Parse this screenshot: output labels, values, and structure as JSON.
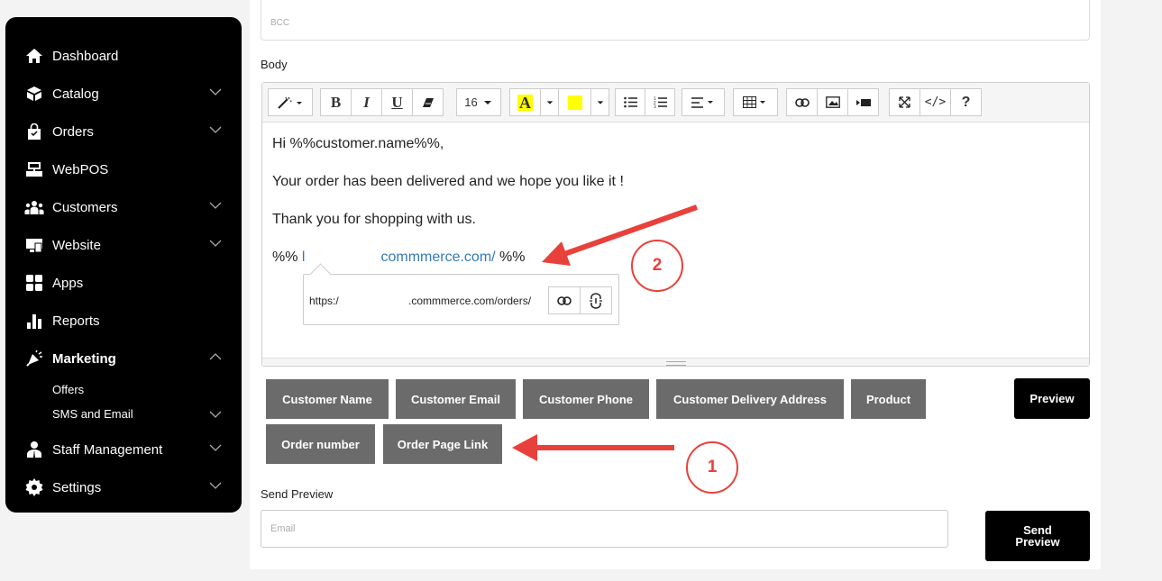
{
  "sidebar": {
    "items": [
      {
        "label": "Dashboard",
        "icon": "home-icon",
        "chevron": false
      },
      {
        "label": "Catalog",
        "icon": "catalog-icon",
        "chevron": true
      },
      {
        "label": "Orders",
        "icon": "shopping-bag-icon",
        "chevron": true
      },
      {
        "label": "WebPOS",
        "icon": "pos-register-icon",
        "chevron": false
      },
      {
        "label": "Customers",
        "icon": "users-icon",
        "chevron": true
      },
      {
        "label": "Website",
        "icon": "website-icon",
        "chevron": true
      },
      {
        "label": "Apps",
        "icon": "apps-grid-icon",
        "chevron": false
      },
      {
        "label": "Reports",
        "icon": "bar-chart-icon",
        "chevron": false
      },
      {
        "label": "Marketing",
        "icon": "megaphone-icon",
        "chevron": true,
        "expanded": true
      },
      {
        "label": "Staff Management",
        "icon": "staff-icon",
        "chevron": true
      },
      {
        "label": "Settings",
        "icon": "gear-icon",
        "chevron": true
      }
    ],
    "marketing_sub": [
      {
        "label": "Offers",
        "chevron": false
      },
      {
        "label": "SMS and Email",
        "chevron": true
      }
    ]
  },
  "bcc": {
    "placeholder": "BCC"
  },
  "body_label": "Body",
  "toolbar": {
    "font_size": "16",
    "highlight_color": "#ffff00"
  },
  "editor": {
    "line1": "Hi %%customer.name%%,",
    "line2": "Your order has been delivered and we hope you like it !",
    "line3": "Thank you for shopping with us.",
    "line4_prefix": "%% ",
    "line4_link_a": "l",
    "line4_link_b": "commmerce.com/",
    "line4_suffix": " %%",
    "link_popup_url_a": "https:/",
    "link_popup_url_b": ".commmerce.com/orders/"
  },
  "placeholders": [
    "Customer Name",
    "Customer Email",
    "Customer Phone",
    "Customer Delivery Address",
    "Product",
    "Order number",
    "Order Page Link"
  ],
  "preview_button": "Preview",
  "send_preview_label": "Send Preview",
  "email": {
    "placeholder": "Email"
  },
  "send_preview_button": "Send Preview",
  "annotations": {
    "first": "1",
    "second": "2"
  },
  "colors": {
    "accent_red": "#e8413c",
    "placeholder_btn": "#6b6b6b",
    "link": "#337ab7"
  }
}
